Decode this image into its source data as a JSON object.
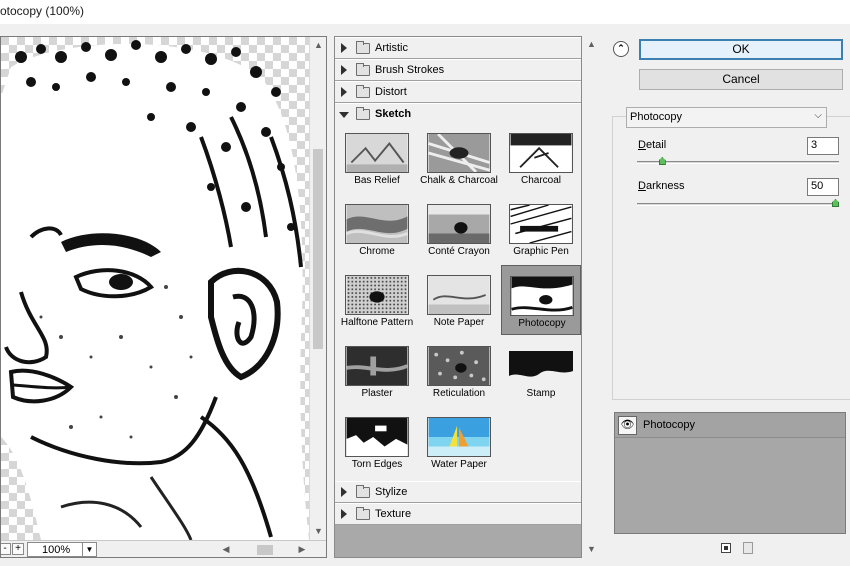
{
  "window": {
    "title": "otocopy (100%)"
  },
  "preview": {
    "zoom": "100%",
    "zoom_out": "-",
    "zoom_in": "+"
  },
  "filters": {
    "categories": [
      {
        "label": "Artistic",
        "expanded": false
      },
      {
        "label": "Brush Strokes",
        "expanded": false
      },
      {
        "label": "Distort",
        "expanded": false
      },
      {
        "label": "Sketch",
        "expanded": true
      },
      {
        "label": "Stylize",
        "expanded": false
      },
      {
        "label": "Texture",
        "expanded": false
      }
    ],
    "sketch_items": [
      {
        "label": "Bas Relief"
      },
      {
        "label": "Chalk & Charcoal"
      },
      {
        "label": "Charcoal"
      },
      {
        "label": "Chrome"
      },
      {
        "label": "Conté Crayon"
      },
      {
        "label": "Graphic Pen"
      },
      {
        "label": "Halftone Pattern"
      },
      {
        "label": "Note Paper"
      },
      {
        "label": "Photocopy"
      },
      {
        "label": "Plaster"
      },
      {
        "label": "Reticulation"
      },
      {
        "label": "Stamp"
      },
      {
        "label": "Torn Edges"
      },
      {
        "label": "Water Paper"
      }
    ],
    "selected": "Photocopy"
  },
  "dialog": {
    "ok_label": "OK",
    "cancel_label": "Cancel",
    "filter_select": "Photocopy",
    "detail": {
      "label_key": "D",
      "label_rest": "etail",
      "value": "3",
      "level": 0.05
    },
    "darkness": {
      "label_key": "D",
      "label_rest": "arkness",
      "value": "50",
      "level": 1.0
    }
  },
  "layers": {
    "items": [
      {
        "label": "Photocopy"
      }
    ]
  },
  "colors": {
    "accent": "#3c7fb1",
    "selected_tile": "#9a9a9a",
    "panel_bg": "#f0f0f0"
  }
}
